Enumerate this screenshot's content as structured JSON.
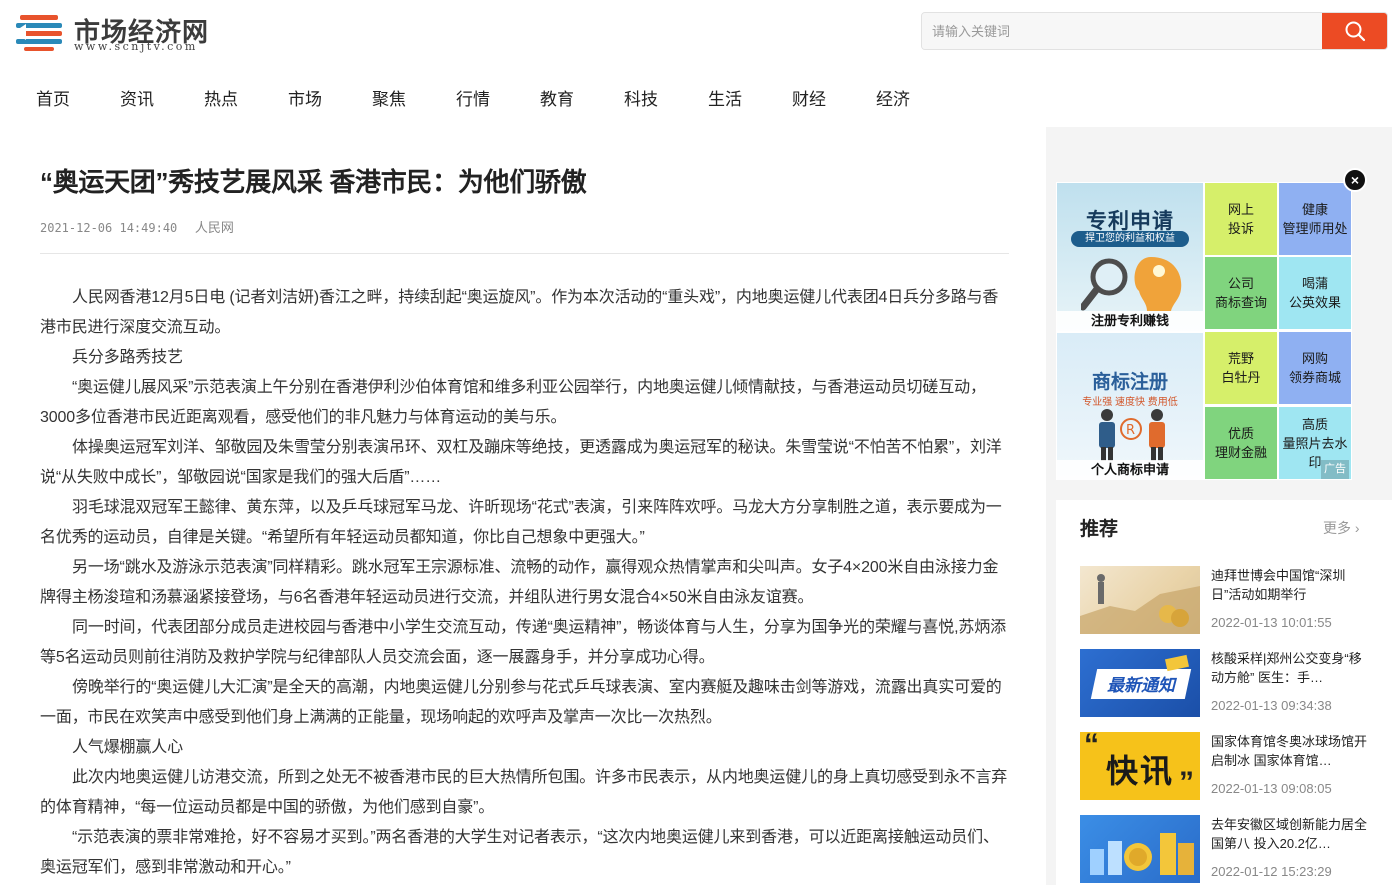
{
  "site": {
    "title": "市场经济网",
    "subtitle": "www.scnjtv.com"
  },
  "search": {
    "placeholder": "请输入关键词",
    "button_icon": "search-icon"
  },
  "nav": {
    "items": [
      "首页",
      "资讯",
      "热点",
      "市场",
      "聚焦",
      "行情",
      "教育",
      "科技",
      "生活",
      "财经",
      "经济"
    ]
  },
  "article": {
    "title": "“奥运天团”秀技艺展风采 香港市民：为他们骄傲",
    "date": "2021-12-06 14:49:40",
    "source": "人民网",
    "paragraphs": [
      "人民网香港12月5日电 (记者刘洁妍)香江之畔，持续刮起“奥运旋风”。作为本次活动的“重头戏”，内地奥运健儿代表团4日兵分多路与香港市民进行深度交流互动。",
      "兵分多路秀技艺",
      "“奥运健儿展风采”示范表演上午分别在香港伊利沙伯体育馆和维多利亚公园举行，内地奥运健儿倾情献技，与香港运动员切磋互动，3000多位香港市民近距离观看，感受他们的非凡魅力与体育运动的美与乐。",
      "体操奥运冠军刘洋、邹敬园及朱雪莹分别表演吊环、双杠及蹦床等绝技，更透露成为奥运冠军的秘诀。朱雪莹说“不怕苦不怕累”，刘洋说“从失败中成长”，邹敬园说“国家是我们的强大后盾”……",
      "羽毛球混双冠军王懿律、黄东萍，以及乒乓球冠军马龙、许昕现场“花式”表演，引来阵阵欢呼。马龙大方分享制胜之道，表示要成为一名优秀的运动员，自律是关键。“希望所有年轻运动员都知道，你比自己想象中更强大。”",
      "另一场“跳水及游泳示范表演”同样精彩。跳水冠军王宗源标准、流畅的动作，赢得观众热情掌声和尖叫声。女子4×200米自由泳接力金牌得主杨浚瑄和汤慕涵紧接登场，与6名香港年轻运动员进行交流，并组队进行男女混合4×50米自由泳友谊赛。",
      "同一时间，代表团部分成员走进校园与香港中小学生交流互动，传递“奥运精神”，畅谈体育与人生，分享为国争光的荣耀与喜悦,苏炳添等5名运动员则前往消防及救护学院与纪律部队人员交流会面，逐一展露身手，并分享成功心得。",
      "傍晚举行的“奥运健儿大汇演”是全天的高潮，内地奥运健儿分别参与花式乒乓球表演、室内赛艇及趣味击剑等游戏，流露出真实可爱的一面，市民在欢笑声中感受到他们身上满满的正能量，现场响起的欢呼声及掌声一次比一次热烈。",
      "人气爆棚赢人心",
      "此次内地奥运健儿访港交流，所到之处无不被香港市民的巨大热情所包围。许多市民表示，从内地奥运健儿的身上真切感受到永不言弃的体育精神，“每一位运动员都是中国的骄傲，为他们感到自豪”。",
      "“示范表演的票非常难抢，好不容易才买到。”两名香港的大学生对记者表示，“这次内地奥运健儿来到香港，可以近距离接触运动员们、奥运冠军们，感到非常激动和开心。”"
    ]
  },
  "ad": {
    "close_label": "×",
    "tag": "广告",
    "big": [
      {
        "headline": "专利申请",
        "subline": "捍卫您的利益和权益",
        "caption": "注册专利赚钱"
      },
      {
        "headline": "商标注册",
        "subline": "专业强  速度快  费用低",
        "caption": "个人商标申请"
      }
    ],
    "cells": [
      {
        "lines": [
          "网上",
          "投诉"
        ],
        "color": "#d6ef6a"
      },
      {
        "lines": [
          "健康",
          "管理师用处"
        ],
        "color": "#8fb0f2"
      },
      {
        "lines": [
          "公司",
          "商标查询"
        ],
        "color": "#80d47e"
      },
      {
        "lines": [
          "喝蒲",
          "公英效果"
        ],
        "color": "#9fe6f2"
      },
      {
        "lines": [
          "荒野",
          "白牡丹"
        ],
        "color": "#d6ef6a"
      },
      {
        "lines": [
          "网购",
          "领券商城"
        ],
        "color": "#8fb0f2"
      },
      {
        "lines": [
          "优质",
          "理财金融"
        ],
        "color": "#80d47e"
      },
      {
        "lines": [
          "高质",
          "量照片去水",
          "印"
        ],
        "color": "#9fe6f2"
      }
    ]
  },
  "recommend": {
    "title": "推荐",
    "more": "更多",
    "items": [
      {
        "text": "迪拜世博会中国馆“深圳日”活动如期举行",
        "time": "2022-01-13 10:01:55",
        "thumb": "finance"
      },
      {
        "text": "核酸采样|郑州公交变身“移动方舱” 医生：手…",
        "time": "2022-01-13 09:34:38",
        "thumb_label": "最新通知"
      },
      {
        "text": "国家体育馆冬奥冰球场馆开启制冰 国家体育馆…",
        "time": "2022-01-13 09:08:05",
        "thumb_label": "快讯"
      },
      {
        "text": "去年安徽区域创新能力居全国第八 投入20.2亿…",
        "time": "2022-01-12 15:23:29",
        "thumb": "coins"
      }
    ]
  },
  "colors": {
    "accent": "#ec4b24",
    "page_bg": "#f4f4f4"
  }
}
